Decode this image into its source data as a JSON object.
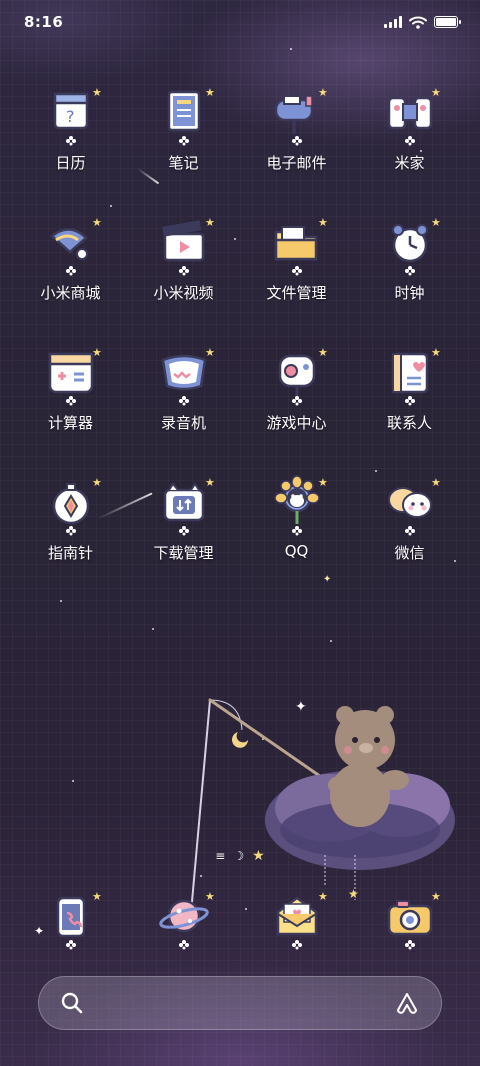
{
  "status_bar": {
    "time": "8:16",
    "icons": [
      "signal-icon",
      "wifi-icon",
      "battery-icon"
    ],
    "battery_level": 1.0
  },
  "apps": [
    {
      "label": "日历",
      "icon": "calendar-icon"
    },
    {
      "label": "笔记",
      "icon": "notes-icon"
    },
    {
      "label": "电子邮件",
      "icon": "mailbox-icon"
    },
    {
      "label": "米家",
      "icon": "smart-home-icon"
    },
    {
      "label": "小米商城",
      "icon": "store-icon"
    },
    {
      "label": "小米视频",
      "icon": "video-clapper-icon"
    },
    {
      "label": "文件管理",
      "icon": "folder-icon"
    },
    {
      "label": "时钟",
      "icon": "alarm-clock-icon"
    },
    {
      "label": "计算器",
      "icon": "calculator-icon"
    },
    {
      "label": "录音机",
      "icon": "recorder-icon"
    },
    {
      "label": "游戏中心",
      "icon": "gamepad-icon"
    },
    {
      "label": "联系人",
      "icon": "contacts-book-icon"
    },
    {
      "label": "指南针",
      "icon": "compass-icon"
    },
    {
      "label": "下载管理",
      "icon": "download-icon"
    },
    {
      "label": "QQ",
      "icon": "qq-icon"
    },
    {
      "label": "微信",
      "icon": "wechat-icon"
    }
  ],
  "page_indicator": {
    "menu_glyph": "≡",
    "moon_glyph": "☽",
    "star_glyph": "★"
  },
  "dock": [
    {
      "icon": "phone-icon"
    },
    {
      "icon": "browser-planet-icon"
    },
    {
      "icon": "messages-envelope-icon"
    },
    {
      "icon": "camera-icon"
    }
  ],
  "search": {
    "placeholder": ""
  },
  "colors": {
    "background": "#2a2437",
    "accent_star": "#f6d97a",
    "icon_outline": "#3c3a5a",
    "icon_white": "#ffffff"
  }
}
